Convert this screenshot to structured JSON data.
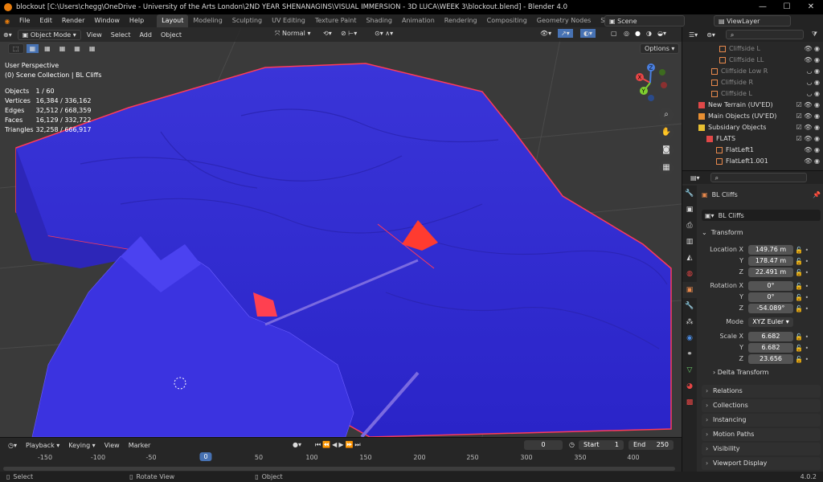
{
  "window": {
    "title": "blockout [C:\\Users\\chegg\\OneDrive - University of the Arts London\\2ND YEAR SHENANAGINS\\VISUAL IMMERSION - 3D LUCA\\WEEK 3\\blockout.blend] - Blender 4.0"
  },
  "menu": {
    "items": [
      "File",
      "Edit",
      "Render",
      "Window",
      "Help"
    ],
    "workspaces": [
      "Layout",
      "Modeling",
      "Sculpting",
      "UV Editing",
      "Texture Paint",
      "Shading",
      "Animation",
      "Rendering",
      "Compositing",
      "Geometry Nodes",
      "Scriptin"
    ],
    "active_workspace": "Layout",
    "scene": "Scene",
    "view_layer": "ViewLayer"
  },
  "viewport": {
    "mode": "Object Mode",
    "menus": [
      "View",
      "Select",
      "Add",
      "Object"
    ],
    "orientation": "Normal",
    "options_label": "Options",
    "perspective": "User Perspective",
    "collection_line": "(0) Scene Collection | BL Cliffs",
    "stats": [
      {
        "label": "Objects",
        "value": "1 / 60"
      },
      {
        "label": "Vertices",
        "value": "16,384 / 336,162"
      },
      {
        "label": "Edges",
        "value": "32,512 / 668,359"
      },
      {
        "label": "Faces",
        "value": "16,129 / 332,722"
      },
      {
        "label": "Triangles",
        "value": "32,258 / 666,917"
      }
    ],
    "gizmo": {
      "x": "X",
      "y": "Y",
      "z": "Z"
    }
  },
  "outliner": {
    "rows": [
      {
        "label": "Cliffside L",
        "depth": 3,
        "color": "#e8894c",
        "dim": true
      },
      {
        "label": "Cliffside LL",
        "depth": 3,
        "color": "#e8894c",
        "dim": true
      },
      {
        "label": "Cliffside Low R",
        "depth": 2,
        "color": "#e8894c",
        "dim": true
      },
      {
        "label": "Cliffside R",
        "depth": 2,
        "color": "#e8894c",
        "dim": true
      },
      {
        "label": "Cliffside L",
        "depth": 2,
        "color": "#e8894c",
        "dim": true
      },
      {
        "label": "New Terrain (UV'ED)",
        "depth": 0,
        "color": "#e04848",
        "dim": false
      },
      {
        "label": "Main Objects (UV'ED)",
        "depth": 0,
        "color": "#e88f32",
        "dim": false
      },
      {
        "label": "Subsidary Objects",
        "depth": 0,
        "color": "#e8c032",
        "dim": false
      },
      {
        "label": "FLATS",
        "depth": 1,
        "color": "#e04848",
        "dim": false
      },
      {
        "label": "FlatLeft1",
        "depth": 2,
        "color": "#e8894c",
        "dim": false
      },
      {
        "label": "FlatLeft1.001",
        "depth": 2,
        "color": "#e8894c",
        "dim": false
      }
    ]
  },
  "properties": {
    "object_name": "BL Cliffs",
    "data_name": "BL Cliffs",
    "transform_label": "Transform",
    "location": {
      "label": "Location X",
      "x": "149.76 m",
      "y": "178.47 m",
      "z": "22.491 m"
    },
    "rotation": {
      "label": "Rotation X",
      "x": "0°",
      "y": "0°",
      "z": "-54.089°"
    },
    "mode": {
      "label": "Mode",
      "value": "XYZ Euler"
    },
    "scale": {
      "label": "Scale X",
      "x": "6.682",
      "y": "6.682",
      "z": "23.656"
    },
    "axis_y": "Y",
    "axis_z": "Z",
    "delta": "Delta Transform",
    "panels": [
      "Relations",
      "Collections",
      "Instancing",
      "Motion Paths",
      "Visibility",
      "Viewport Display"
    ]
  },
  "timeline": {
    "menus": [
      "Playback",
      "Keying",
      "View",
      "Marker"
    ],
    "current_frame": "0",
    "start_label": "Start",
    "start": "1",
    "end_label": "End",
    "end": "250",
    "ticks": [
      "-150",
      "-100",
      "-50",
      "0",
      "50",
      "100",
      "150",
      "200",
      "250",
      "300",
      "350",
      "400"
    ]
  },
  "statusbar": {
    "select": "Select",
    "rotate": "Rotate View",
    "object": "Object",
    "version": "4.0.2"
  },
  "colors": {
    "terrain": "#3a2ee0",
    "highlight": "#ff3030",
    "accent": "#4772b3"
  }
}
